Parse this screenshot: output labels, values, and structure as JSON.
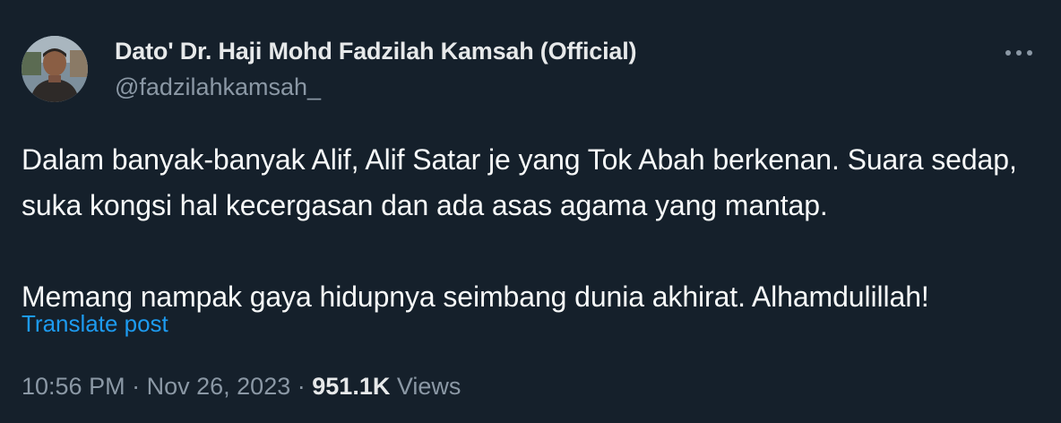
{
  "author": {
    "display_name": "Dato' Dr. Haji Mohd Fadzilah Kamsah (Official)",
    "handle": "@fadzilahkamsah_",
    "avatar_icon": "profile-photo"
  },
  "menu": {
    "more_icon": "more-horizontal-icon"
  },
  "post": {
    "text": "Dalam banyak-banyak Alif, Alif Satar je yang Tok Abah berkenan. Suara sedap, suka kongsi hal kecergasan dan ada asas agama yang mantap.\n\nMemang nampak gaya hidupnya seimbang dunia akhirat. Alhamdulillah!",
    "translate_label": "Translate post"
  },
  "meta": {
    "time": "10:56 PM",
    "separator": "·",
    "date": "Nov 26, 2023",
    "views_count": "951.1K",
    "views_label": "Views"
  },
  "colors": {
    "background": "#15202b",
    "text": "#f7f9f9",
    "secondary": "#8b98a5",
    "link": "#1d9bf0"
  }
}
